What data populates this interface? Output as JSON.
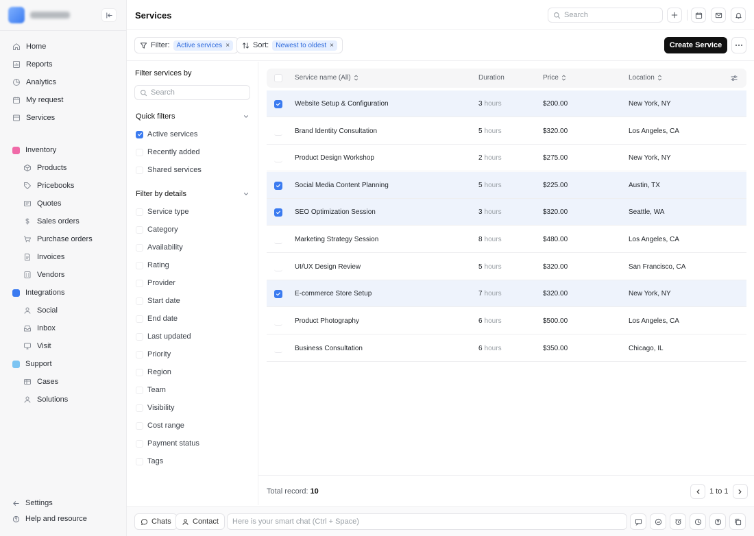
{
  "sidebar": {
    "nav": [
      {
        "label": "Home",
        "icon": "home-icon"
      },
      {
        "label": "Reports",
        "icon": "reports-icon"
      },
      {
        "label": "Analytics",
        "icon": "analytics-icon"
      },
      {
        "label": "My request",
        "icon": "calendar-icon"
      },
      {
        "label": "Services",
        "icon": "services-icon"
      }
    ],
    "groups": [
      {
        "label": "Inventory",
        "color": "#f06aa8",
        "items": [
          "Products",
          "Pricebooks",
          "Quotes",
          "Sales orders",
          "Purchase orders",
          "Invoices",
          "Vendors"
        ]
      },
      {
        "label": "Integrations",
        "color": "#3b7bf0",
        "items": [
          "Social",
          "Inbox",
          "Visit"
        ]
      },
      {
        "label": "Support",
        "color": "#7cc4f2",
        "items": [
          "Cases",
          "Solutions"
        ]
      }
    ],
    "settings": "Settings",
    "help": "Help and resource"
  },
  "header": {
    "title": "Services",
    "search_placeholder": "Search"
  },
  "toolbar": {
    "filter_label": "Filter:",
    "filter_value": "Active services",
    "sort_label": "Sort:",
    "sort_value": "Newest to oldest",
    "create_label": "Create Service"
  },
  "filters": {
    "title": "Filter services by",
    "search_placeholder": "Search",
    "quick_title": "Quick filters",
    "quick": [
      {
        "label": "Active services",
        "checked": true
      },
      {
        "label": "Recently added",
        "checked": false
      },
      {
        "label": "Shared services",
        "checked": false
      }
    ],
    "details_title": "Filter by details",
    "details": [
      "Service type",
      "Category",
      "Availability",
      "Rating",
      "Provider",
      "Start date",
      "End date",
      "Last updated",
      "Priority",
      "Region",
      "Team",
      "Visibility",
      "Cost range",
      "Payment status",
      "Tags"
    ]
  },
  "table": {
    "columns": {
      "name": "Service name (All)",
      "duration": "Duration",
      "price": "Price",
      "location": "Location"
    },
    "unit": "hours",
    "rows": [
      {
        "name": "Website Setup & Configuration",
        "duration": "3",
        "price": "$200.00",
        "location": "New York, NY",
        "selected": true
      },
      {
        "name": "Brand Identity Consultation",
        "duration": "5",
        "price": "$320.00",
        "location": "Los Angeles, CA",
        "selected": false
      },
      {
        "name": "Product Design Workshop",
        "duration": "2",
        "price": "$275.00",
        "location": "New York, NY",
        "selected": false
      },
      {
        "name": "Social Media Content Planning",
        "duration": "5",
        "price": "$225.00",
        "location": "Austin, TX",
        "selected": true
      },
      {
        "name": "SEO Optimization Session",
        "duration": "3",
        "price": "$320.00",
        "location": "Seattle, WA",
        "selected": true
      },
      {
        "name": "Marketing Strategy Session",
        "duration": "8",
        "price": "$480.00",
        "location": "Los Angeles, CA",
        "selected": false
      },
      {
        "name": "UI/UX Design Review",
        "duration": "5",
        "price": "$320.00",
        "location": "San Francisco, CA",
        "selected": false
      },
      {
        "name": "E-commerce Store Setup",
        "duration": "7",
        "price": "$320.00",
        "location": "New York, NY",
        "selected": true
      },
      {
        "name": "Product Photography",
        "duration": "6",
        "price": "$500.00",
        "location": "Los Angeles, CA",
        "selected": false
      },
      {
        "name": "Business Consultation",
        "duration": "6",
        "price": "$350.00",
        "location": "Chicago, IL",
        "selected": false
      }
    ]
  },
  "footer": {
    "total_label": "Total record:",
    "total_value": "10",
    "page_text": "1 to 1"
  },
  "chatbar": {
    "chats": "Chats",
    "contact": "Contact",
    "placeholder": "Here is your smart chat (Ctrl + Space)"
  }
}
